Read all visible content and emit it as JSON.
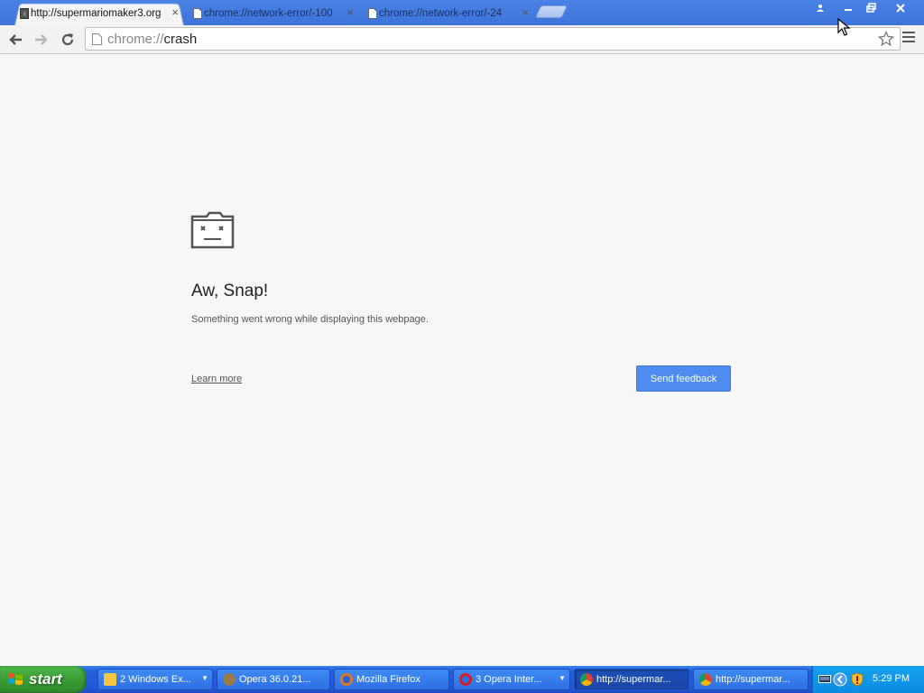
{
  "tabs": [
    {
      "title": "http://supermariomaker3.org",
      "close": "×",
      "active": true
    },
    {
      "title": "chrome://network-error/-100",
      "close": "×",
      "active": false
    },
    {
      "title": "chrome://network-error/-24",
      "close": "×",
      "active": false
    }
  ],
  "window_controls": {
    "profile": "profile-icon",
    "minimize": "minimize-icon",
    "restore": "restore-icon",
    "close": "close-icon"
  },
  "toolbar": {
    "url_scheme": "chrome://",
    "url_rest": "crash"
  },
  "error_page": {
    "title": "Aw, Snap!",
    "message": "Something went wrong while displaying this webpage.",
    "learn_more": "Learn more",
    "feedback_button": "Send feedback"
  },
  "taskbar": {
    "start_label": "start",
    "tasks": [
      {
        "label": "2 Windows Ex...",
        "icon_color": "#f3c644"
      },
      {
        "label": "Opera 36.0.21...",
        "icon_color": "#9b7a4a"
      },
      {
        "label": "Mozilla Firefox",
        "icon_color": "#e8731c"
      },
      {
        "label": "3 Opera Inter...",
        "icon_color": "#d41f26"
      },
      {
        "label": "http://supermar...",
        "icon_color": "#3aa757"
      },
      {
        "label": "http://supermar...",
        "icon_color": "#3aa757"
      }
    ],
    "clock": "5:29 PM"
  },
  "colors": {
    "accent": "#4e8cf0",
    "taskbar": "#245edb",
    "start": "#3a9d36"
  }
}
